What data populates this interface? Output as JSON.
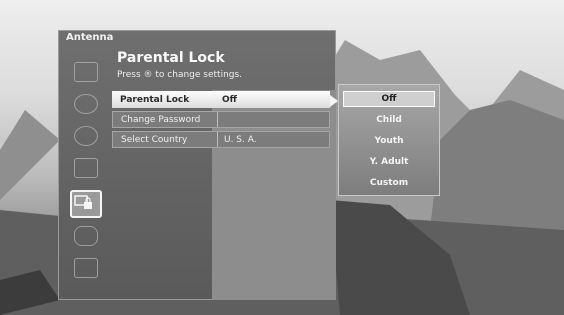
{
  "app": {
    "section_label": "Antenna"
  },
  "menu": {
    "heading": "Parental Lock",
    "subheading": "Press ® to change settings.",
    "rows": [
      {
        "label": "Parental Lock",
        "value": "Off"
      },
      {
        "label": "Change Password",
        "value": ""
      },
      {
        "label": "Select Country",
        "value": "U. S. A."
      }
    ]
  },
  "options": {
    "items": [
      "Off",
      "Child",
      "Youth",
      "Y. Adult",
      "Custom"
    ],
    "selected_index": 0
  },
  "sidebar": {
    "icons": [
      "picture-icon",
      "sound-icon",
      "channel-icon",
      "setup-icon",
      "parental-lock-icon",
      "input-icon",
      "general-icon"
    ],
    "active_index": 4
  },
  "colors": {
    "highlight": "#f2f2f2",
    "panel": "#666666"
  }
}
